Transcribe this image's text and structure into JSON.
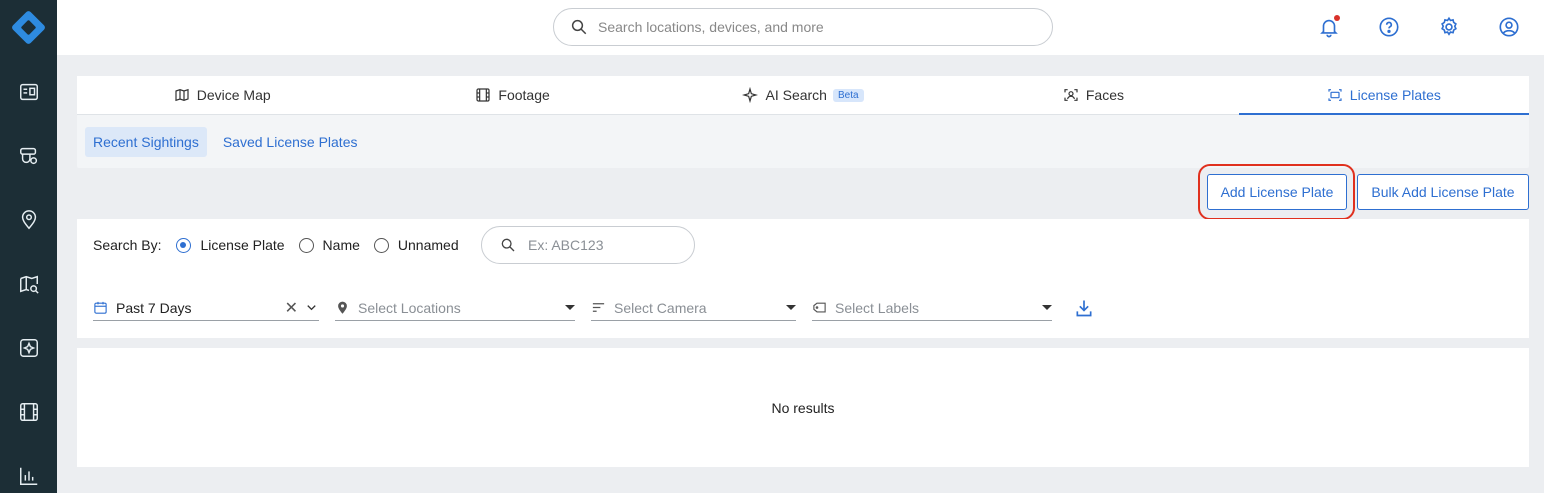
{
  "search": {
    "placeholder": "Search locations, devices, and more"
  },
  "tabs": [
    {
      "label": "Device Map",
      "icon": "map-icon",
      "active": false
    },
    {
      "label": "Footage",
      "icon": "film-icon",
      "active": false
    },
    {
      "label": "AI Search",
      "icon": "sparkle-icon",
      "active": false,
      "badge": "Beta"
    },
    {
      "label": "Faces",
      "icon": "face-scan-icon",
      "active": false
    },
    {
      "label": "License Plates",
      "icon": "license-plate-icon",
      "active": true
    }
  ],
  "subtabs": [
    {
      "label": "Recent Sightings",
      "active": true
    },
    {
      "label": "Saved License Plates",
      "active": false
    }
  ],
  "actions": {
    "add_label": "Add License Plate",
    "bulk_label": "Bulk Add License Plate"
  },
  "filters": {
    "search_by_label": "Search By:",
    "radios": [
      {
        "label": "License Plate",
        "checked": true
      },
      {
        "label": "Name",
        "checked": false
      },
      {
        "label": "Unnamed",
        "checked": false
      }
    ],
    "plate_placeholder": "Ex: ABC123",
    "date_value": "Past 7 Days",
    "locations_placeholder": "Select Locations",
    "camera_placeholder": "Select Camera",
    "labels_placeholder": "Select Labels"
  },
  "results": {
    "empty_text": "No results"
  },
  "colors": {
    "accent": "#2e6fd1",
    "sidebar": "#1c2e36",
    "highlight": "#e0301e"
  }
}
